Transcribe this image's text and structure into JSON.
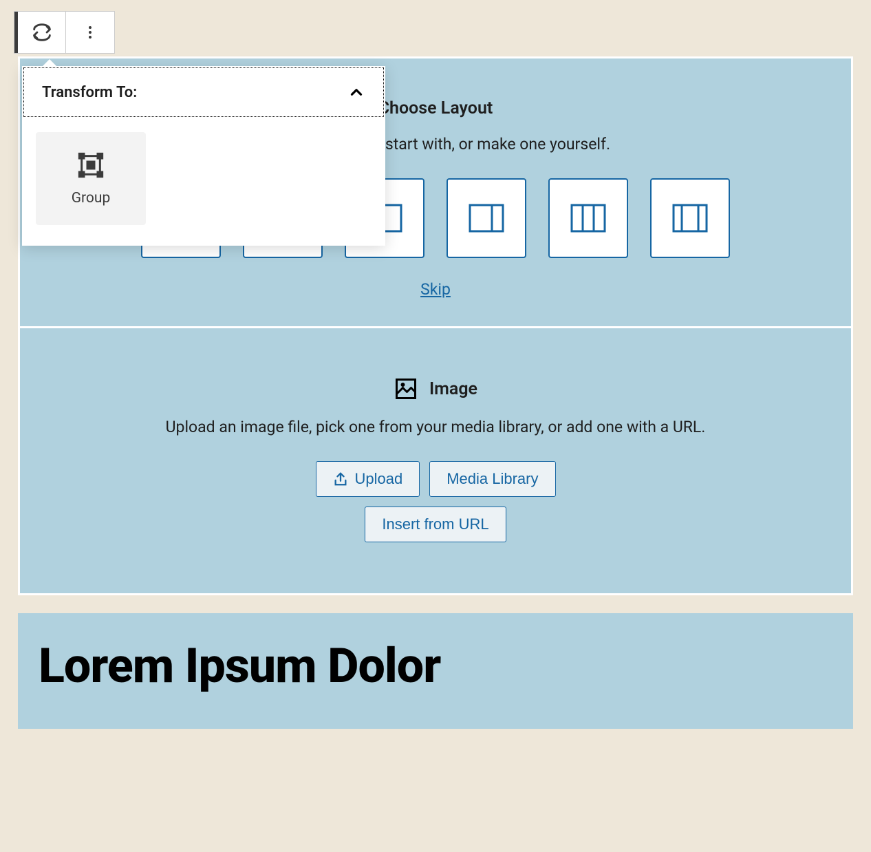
{
  "toolbar": {
    "transform_icon": "transform",
    "options_icon": "more"
  },
  "popover": {
    "title": "Transform To:",
    "options": [
      {
        "label": "Group"
      }
    ]
  },
  "layout_block": {
    "title": "Choose Layout",
    "description": "Select a layout to start with, or make one yourself.",
    "skip_label": "Skip"
  },
  "image_block": {
    "title": "Image",
    "description": "Upload an image file, pick one from your media library, or add one with a URL.",
    "upload_label": "Upload",
    "media_library_label": "Media Library",
    "insert_url_label": "Insert from URL"
  },
  "heading_block": {
    "text": "Lorem Ipsum Dolor"
  }
}
